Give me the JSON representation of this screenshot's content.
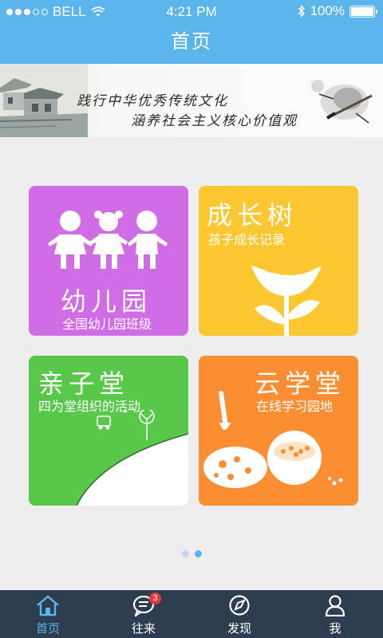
{
  "status_bar": {
    "carrier": "BELL",
    "time": "4:21 PM",
    "battery": "100%",
    "battery_level": 1.0,
    "signal_bars": 3,
    "signal_total": 5
  },
  "header": {
    "title": "首页"
  },
  "banner": {
    "line1": "践行中华优秀传统文化",
    "line2": "涵养社会主义核心价值观"
  },
  "tiles": [
    {
      "title": "幼儿园",
      "subtitle": "全国幼儿园班级",
      "color": "#d06ce6"
    },
    {
      "title": "成长树",
      "subtitle": "孩子成长记录",
      "color": "#fdc731"
    },
    {
      "title": "亲子堂",
      "subtitle": "四为堂组织的活动",
      "color": "#59c84a"
    },
    {
      "title": "云学堂",
      "subtitle": "在线学习园地",
      "color": "#fb8d32"
    }
  ],
  "pager": {
    "total": 2,
    "active": 2
  },
  "tab_bar": {
    "items": [
      {
        "label": "首页",
        "icon": "home-icon",
        "active": true
      },
      {
        "label": "往来",
        "icon": "chat-icon",
        "badge": "3"
      },
      {
        "label": "发现",
        "icon": "compass-icon"
      },
      {
        "label": "我",
        "icon": "person-icon"
      }
    ]
  },
  "colors": {
    "primary": "#5ab6ea",
    "tab_bar_bg": "#2e3d4f",
    "badge": "#e53935"
  }
}
